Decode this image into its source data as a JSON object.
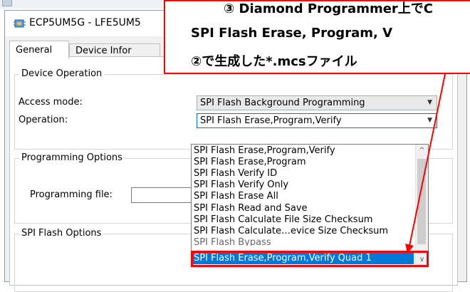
{
  "window": {
    "title": "ECP5UM5G - LFE5UM5",
    "accent": "#0078d7"
  },
  "tabs": [
    {
      "label": "General"
    },
    {
      "label": "Device Infor"
    }
  ],
  "device_operation": {
    "legend": "Device Operation",
    "access_label": "Access mode:",
    "access_value": "SPI Flash Background Programming",
    "operation_label": "Operation:",
    "operation_value": "SPI Flash Erase,Program,Verify"
  },
  "programming_options": {
    "legend": "Programming Options",
    "file_label": "Programming file:",
    "file_value": ""
  },
  "spi_flash_options": {
    "legend": "SPI Flash Options"
  },
  "operation_dropdown": {
    "options": [
      "SPI Flash Erase,Program,Verify",
      "SPI Flash Erase,Program",
      "SPI Flash Verify ID",
      "SPI Flash Verify Only",
      "SPI Flash Erase All",
      "SPI Flash Read and Save",
      "SPI Flash Calculate File Size Checksum",
      "SPI Flash Calculate…evice Size Checksum",
      "SPI Flash Bypass",
      "SPI Flash Erase,Program,Verify Quad 1"
    ],
    "selected_index": 9
  },
  "annotation": {
    "line1": "③ Diamond Programmer上でC",
    "line2": "SPI Flash Erase, Program, V",
    "line3": "②で生成した*.mcsファイル",
    "color": "#ff0000"
  }
}
